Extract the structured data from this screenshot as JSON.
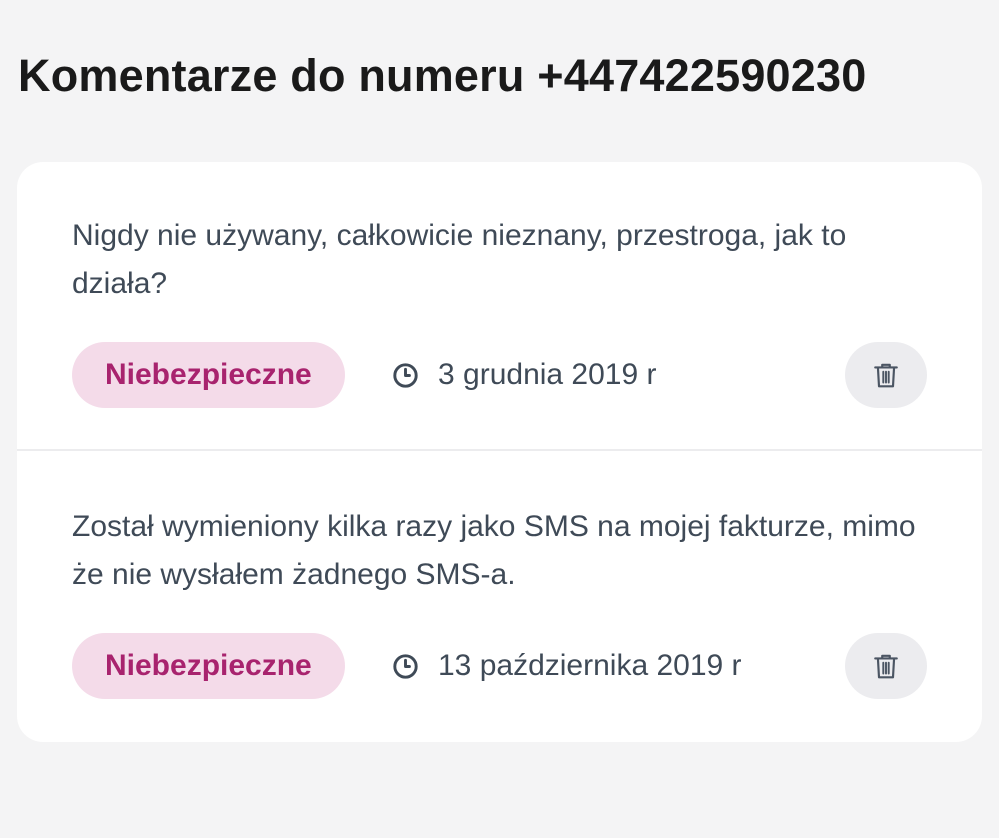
{
  "page": {
    "title": "Komentarze do numeru +447422590230"
  },
  "comments": [
    {
      "text": "Nigdy nie używany, całkowicie nieznany, przestroga, jak to działa?",
      "badge": "Niebezpieczne",
      "date": "3 grudnia 2019 r"
    },
    {
      "text": "Został wymieniony kilka razy jako SMS na mojej fakturze, mimo że nie wysłałem żadnego SMS-a.",
      "badge": "Niebezpieczne",
      "date": "13 października 2019 r"
    }
  ],
  "icons": {
    "date": "clock-icon",
    "delete": "trash-icon"
  },
  "colors": {
    "background": "#f4f4f5",
    "card": "#ffffff",
    "badge_bg": "#f4dbe9",
    "badge_text": "#a8236e",
    "body_text": "#3f4a57",
    "title_text": "#1a1a1a",
    "button_bg": "#ececef"
  }
}
